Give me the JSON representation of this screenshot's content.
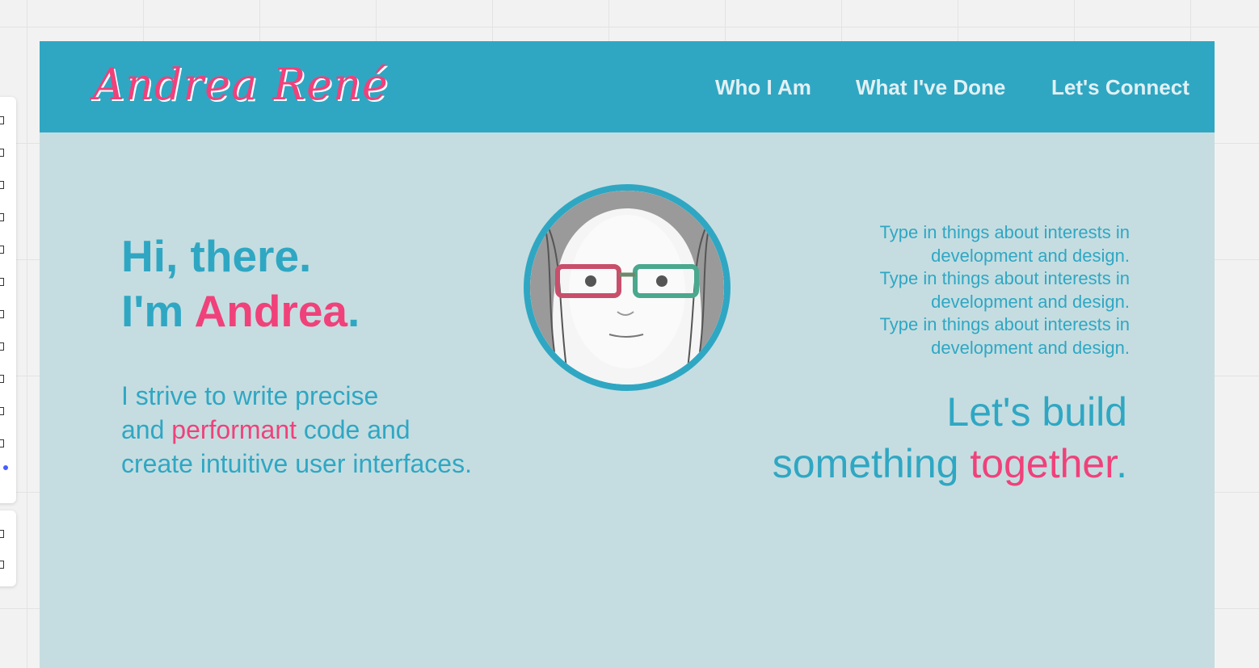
{
  "logo": "Andrea René",
  "nav": {
    "who": "Who I Am",
    "done": "What I've Done",
    "connect": "Let's Connect"
  },
  "hero": {
    "line1": "Hi, there.",
    "line2_prefix": "I'm ",
    "line2_name": "Andrea",
    "line2_suffix": "."
  },
  "tagline": {
    "line1": "I strive to write precise",
    "line2_prefix": "and ",
    "line2_highlight": "performant",
    "line2_suffix": " code and",
    "line3": "create intuitive user interfaces."
  },
  "interests": [
    "Type in things about interests in",
    "development and design.",
    "Type in things about interests in",
    "development and design.",
    "Type in things about interests in",
    "development and design."
  ],
  "cta": {
    "line1": "Let's build",
    "line2_prefix": "something ",
    "line2_highlight": "together",
    "line2_suffix": "."
  },
  "colors": {
    "header": "#2fa7c3",
    "background": "#c5dde1",
    "accent": "#f0417a",
    "nav_text": "#e2f0f3"
  },
  "icons": {
    "avatar": "portrait-sketch-image"
  }
}
